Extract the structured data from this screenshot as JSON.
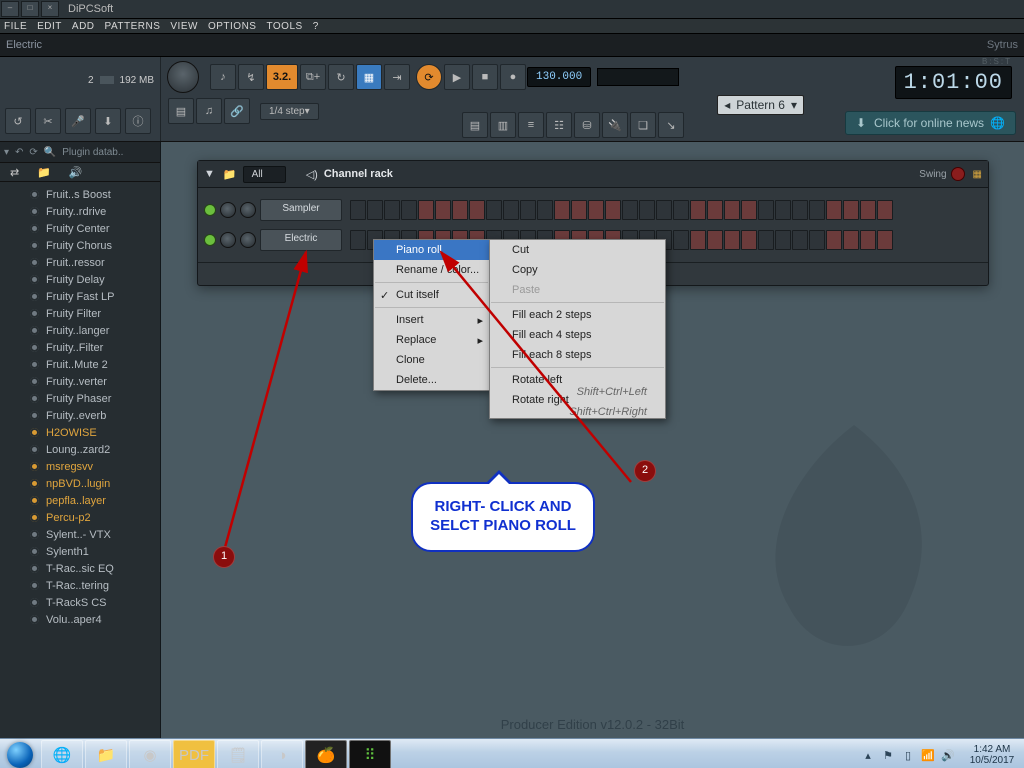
{
  "window": {
    "title": "DiPCSoft"
  },
  "menus": [
    "FILE",
    "EDIT",
    "ADD",
    "PATTERNS",
    "VIEW",
    "OPTIONS",
    "TOOLS",
    "?"
  ],
  "hint": {
    "left": "Electric",
    "right": "Sytrus"
  },
  "meters": {
    "cpu": "2",
    "mem": "192 MB"
  },
  "transport": {
    "tempo": "130.000",
    "snap": "1/4 step"
  },
  "clock": {
    "label": "B:S:T",
    "value": "1:01:00"
  },
  "pattern": {
    "label": "Pattern 6"
  },
  "news": {
    "text": "Click for online news"
  },
  "browser": {
    "title": "Plugin datab..",
    "items": [
      {
        "label": "Fruit..s Boost",
        "gold": false
      },
      {
        "label": "Fruity..rdrive",
        "gold": false
      },
      {
        "label": "Fruity Center",
        "gold": false
      },
      {
        "label": "Fruity Chorus",
        "gold": false
      },
      {
        "label": "Fruit..ressor",
        "gold": false
      },
      {
        "label": "Fruity Delay",
        "gold": false
      },
      {
        "label": "Fruity Fast LP",
        "gold": false
      },
      {
        "label": "Fruity Filter",
        "gold": false
      },
      {
        "label": "Fruity..langer",
        "gold": false
      },
      {
        "label": "Fruity..Filter",
        "gold": false
      },
      {
        "label": "Fruit..Mute 2",
        "gold": false
      },
      {
        "label": "Fruity..verter",
        "gold": false
      },
      {
        "label": "Fruity Phaser",
        "gold": false
      },
      {
        "label": "Fruity..everb",
        "gold": false
      },
      {
        "label": "H2OWISE",
        "gold": true
      },
      {
        "label": "Loung..zard2",
        "gold": false
      },
      {
        "label": "msregsvv",
        "gold": true
      },
      {
        "label": "npBVD..lugin",
        "gold": true
      },
      {
        "label": "pepfla..layer",
        "gold": true
      },
      {
        "label": "Percu-p2",
        "gold": true
      },
      {
        "label": "Sylent..- VTX",
        "gold": false
      },
      {
        "label": "Sylenth1",
        "gold": false
      },
      {
        "label": "T-Rac..sic EQ",
        "gold": false
      },
      {
        "label": "T-Rac..tering",
        "gold": false
      },
      {
        "label": "T-RackS CS",
        "gold": false
      },
      {
        "label": "Volu..aper4",
        "gold": false
      }
    ]
  },
  "rack": {
    "title": "Channel rack",
    "filter": "All",
    "swing_label": "Swing",
    "channels": [
      {
        "name": "Sampler"
      },
      {
        "name": "Electric"
      }
    ]
  },
  "context_menu_1": {
    "items": [
      {
        "label": "Piano roll",
        "selected": true
      },
      {
        "label": "Rename / color..."
      },
      {
        "label": "Cut itself",
        "checked": true
      },
      {
        "label": "Insert",
        "arrow": true
      },
      {
        "label": "Replace",
        "arrow": true
      },
      {
        "label": "Clone"
      },
      {
        "label": "Delete..."
      }
    ]
  },
  "context_menu_2": {
    "items": [
      {
        "label": "Cut"
      },
      {
        "label": "Copy"
      },
      {
        "label": "Paste",
        "disabled": true
      },
      {
        "sep": true
      },
      {
        "label": "Fill each 2 steps"
      },
      {
        "label": "Fill each 4 steps"
      },
      {
        "label": "Fill each 8 steps"
      },
      {
        "sep": true
      },
      {
        "label": "Rotate left",
        "shortcut": "Shift+Ctrl+Left"
      },
      {
        "label": "Rotate right",
        "shortcut": "Shift+Ctrl+Right"
      }
    ]
  },
  "annotation": {
    "bubble": "RIGHT-\nCLICK AND\nSELCT\nPIANO ROLL",
    "badge1": "1",
    "badge2": "2"
  },
  "edition": "Producer Edition v12.0.2 - 32Bit",
  "taskbar": {
    "time": "1:42 AM",
    "date": "10/5/2017"
  }
}
